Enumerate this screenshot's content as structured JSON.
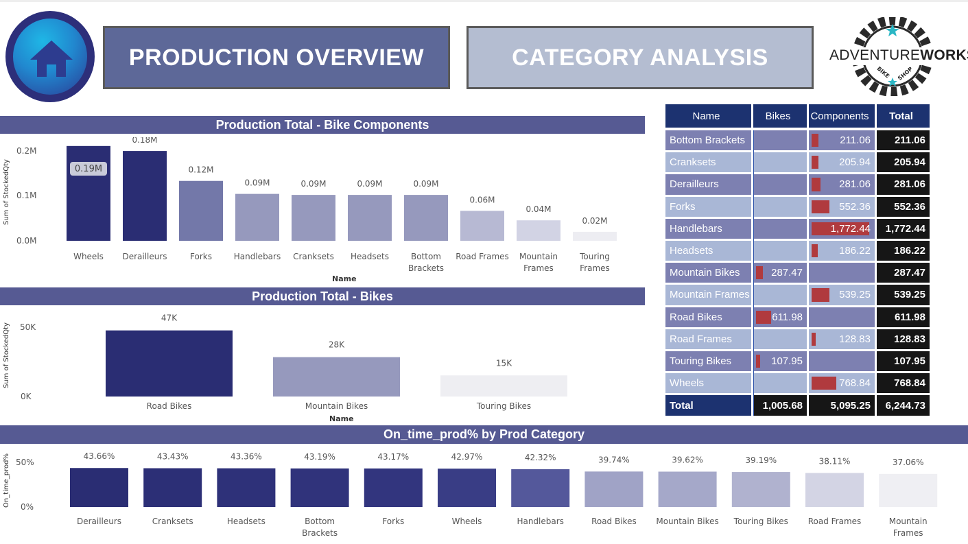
{
  "header": {
    "home_icon": "home-icon",
    "btn_production": "PRODUCTION OVERVIEW",
    "btn_category": "CATEGORY ANALYSIS",
    "logo": {
      "brand_light": "ADVENTURE",
      "brand_bold": "WORKS",
      "word1": "BIKE",
      "word2": "SHOP"
    }
  },
  "colors": {
    "dark": "#2a2d73",
    "section": "#565a93",
    "nav_dark": "#5d6898",
    "nav_light": "#b4bdd1",
    "bar_red": "#b03a3e"
  },
  "components_chart": {
    "header": "Production Total - Bike Components",
    "ylabel": "Sum of StockedQty",
    "xlabel": "Name",
    "yticks": [
      "0.2M",
      "0.1M",
      "0.0M"
    ],
    "tooltip": "0.19M",
    "categories": [
      "Wheels",
      "Derailleurs",
      "Forks",
      "Handlebars",
      "Cranksets",
      "Headsets",
      "Bottom Brackets",
      "Road Frames",
      "Mountain Frames",
      "Touring Frames"
    ],
    "labels": [
      "",
      "0.18M",
      "0.12M",
      "0.09M",
      "0.09M",
      "0.09M",
      "0.09M",
      "0.06M",
      "0.04M",
      "0.02M"
    ]
  },
  "bikes_chart": {
    "header": "Production Total - Bikes",
    "ylabel": "Sum of StockedQty",
    "xlabel": "Name",
    "yticks": [
      "50K",
      "0K"
    ],
    "categories": [
      "Road Bikes",
      "Mountain Bikes",
      "Touring Bikes"
    ],
    "labels": [
      "47K",
      "28K",
      "15K"
    ]
  },
  "ontime_chart": {
    "header": "On_time_prod% by Prod Category",
    "ylabel": "On_time_prod%",
    "yticks": [
      "50%",
      "0%"
    ],
    "categories": [
      "Derailleurs",
      "Cranksets",
      "Headsets",
      "Bottom Brackets",
      "Forks",
      "Wheels",
      "Handlebars",
      "Road Bikes",
      "Mountain Bikes",
      "Touring Bikes",
      "Road Frames",
      "Mountain Frames"
    ],
    "labels": [
      "43.66%",
      "43.43%",
      "43.36%",
      "43.19%",
      "43.17%",
      "42.97%",
      "42.32%",
      "39.74%",
      "39.62%",
      "39.19%",
      "38.11%",
      "37.06%"
    ]
  },
  "matrix": {
    "headers": [
      "Name",
      "Bikes",
      "Components",
      "Total"
    ],
    "rows": [
      {
        "name": "Bottom Brackets",
        "bikes": "",
        "components": "211.06",
        "total": "211.06"
      },
      {
        "name": "Cranksets",
        "bikes": "",
        "components": "205.94",
        "total": "205.94"
      },
      {
        "name": "Derailleurs",
        "bikes": "",
        "components": "281.06",
        "total": "281.06"
      },
      {
        "name": "Forks",
        "bikes": "",
        "components": "552.36",
        "total": "552.36"
      },
      {
        "name": "Handlebars",
        "bikes": "",
        "components": "1,772.44",
        "total": "1,772.44"
      },
      {
        "name": "Headsets",
        "bikes": "",
        "components": "186.22",
        "total": "186.22"
      },
      {
        "name": "Mountain Bikes",
        "bikes": "287.47",
        "components": "",
        "total": "287.47"
      },
      {
        "name": "Mountain Frames",
        "bikes": "",
        "components": "539.25",
        "total": "539.25"
      },
      {
        "name": "Road Bikes",
        "bikes": "611.98",
        "components": "",
        "total": "611.98"
      },
      {
        "name": "Road Frames",
        "bikes": "",
        "components": "128.83",
        "total": "128.83"
      },
      {
        "name": "Touring Bikes",
        "bikes": "107.95",
        "components": "",
        "total": "107.95"
      },
      {
        "name": "Wheels",
        "bikes": "",
        "components": "768.84",
        "total": "768.84"
      }
    ],
    "total_row": {
      "name": "Total",
      "bikes": "1,005.68",
      "components": "5,095.25",
      "total": "6,244.73"
    }
  },
  "chart_data": [
    {
      "type": "bar",
      "title": "Production Total - Bike Components",
      "xlabel": "Name",
      "ylabel": "Sum of StockedQty",
      "categories": [
        "Wheels",
        "Derailleurs",
        "Forks",
        "Handlebars",
        "Cranksets",
        "Headsets",
        "Bottom Brackets",
        "Road Frames",
        "Mountain Frames",
        "Touring Frames"
      ],
      "values": [
        190000,
        180000,
        120000,
        94000,
        92000,
        92000,
        92000,
        60000,
        41000,
        18000
      ],
      "ylim": [
        0,
        220000
      ],
      "colors": [
        "#2a2d73",
        "#2a2d73",
        "#7378a9",
        "#9699bd",
        "#9699bd",
        "#9699bd",
        "#9699bd",
        "#b7b9d3",
        "#d2d3e4",
        "#ededf2"
      ]
    },
    {
      "type": "bar",
      "title": "Production Total - Bikes",
      "xlabel": "Name",
      "ylabel": "Sum of StockedQty",
      "categories": [
        "Road Bikes",
        "Mountain Bikes",
        "Touring Bikes"
      ],
      "values": [
        47000,
        28000,
        15000
      ],
      "ylim": [
        0,
        60000
      ],
      "colors": [
        "#2a2d73",
        "#9699bd",
        "#eeeef2"
      ]
    },
    {
      "type": "bar",
      "title": "On_time_prod% by Prod Category",
      "ylabel": "On_time_prod%",
      "categories": [
        "Derailleurs",
        "Cranksets",
        "Headsets",
        "Bottom Brackets",
        "Forks",
        "Wheels",
        "Handlebars",
        "Road Bikes",
        "Mountain Bikes",
        "Touring Bikes",
        "Road Frames",
        "Mountain Frames"
      ],
      "values": [
        43.66,
        43.43,
        43.36,
        43.19,
        43.17,
        42.97,
        42.32,
        39.74,
        39.62,
        39.19,
        38.11,
        37.06
      ],
      "ylim": [
        0,
        50
      ],
      "colors": [
        "#2a2d73",
        "#2c2f76",
        "#2e3179",
        "#30337b",
        "#32357e",
        "#393d85",
        "#54589b",
        "#a0a3c6",
        "#a5a8c9",
        "#b0b2cf",
        "#d3d4e4",
        "#efeff3"
      ]
    },
    {
      "type": "table",
      "columns": [
        "Name",
        "Bikes",
        "Components",
        "Total"
      ],
      "bikes_values": [
        0,
        0,
        0,
        0,
        0,
        0,
        287.47,
        0,
        611.98,
        0,
        107.95,
        0
      ],
      "components_values": [
        211.06,
        205.94,
        281.06,
        552.36,
        1772.44,
        186.22,
        0,
        539.25,
        0,
        128.83,
        0,
        768.84
      ],
      "totals": [
        211.06,
        205.94,
        281.06,
        552.36,
        1772.44,
        186.22,
        287.47,
        539.25,
        611.98,
        128.83,
        107.95,
        768.84
      ],
      "grand_total": [
        1005.68,
        5095.25,
        6244.73
      ]
    }
  ]
}
